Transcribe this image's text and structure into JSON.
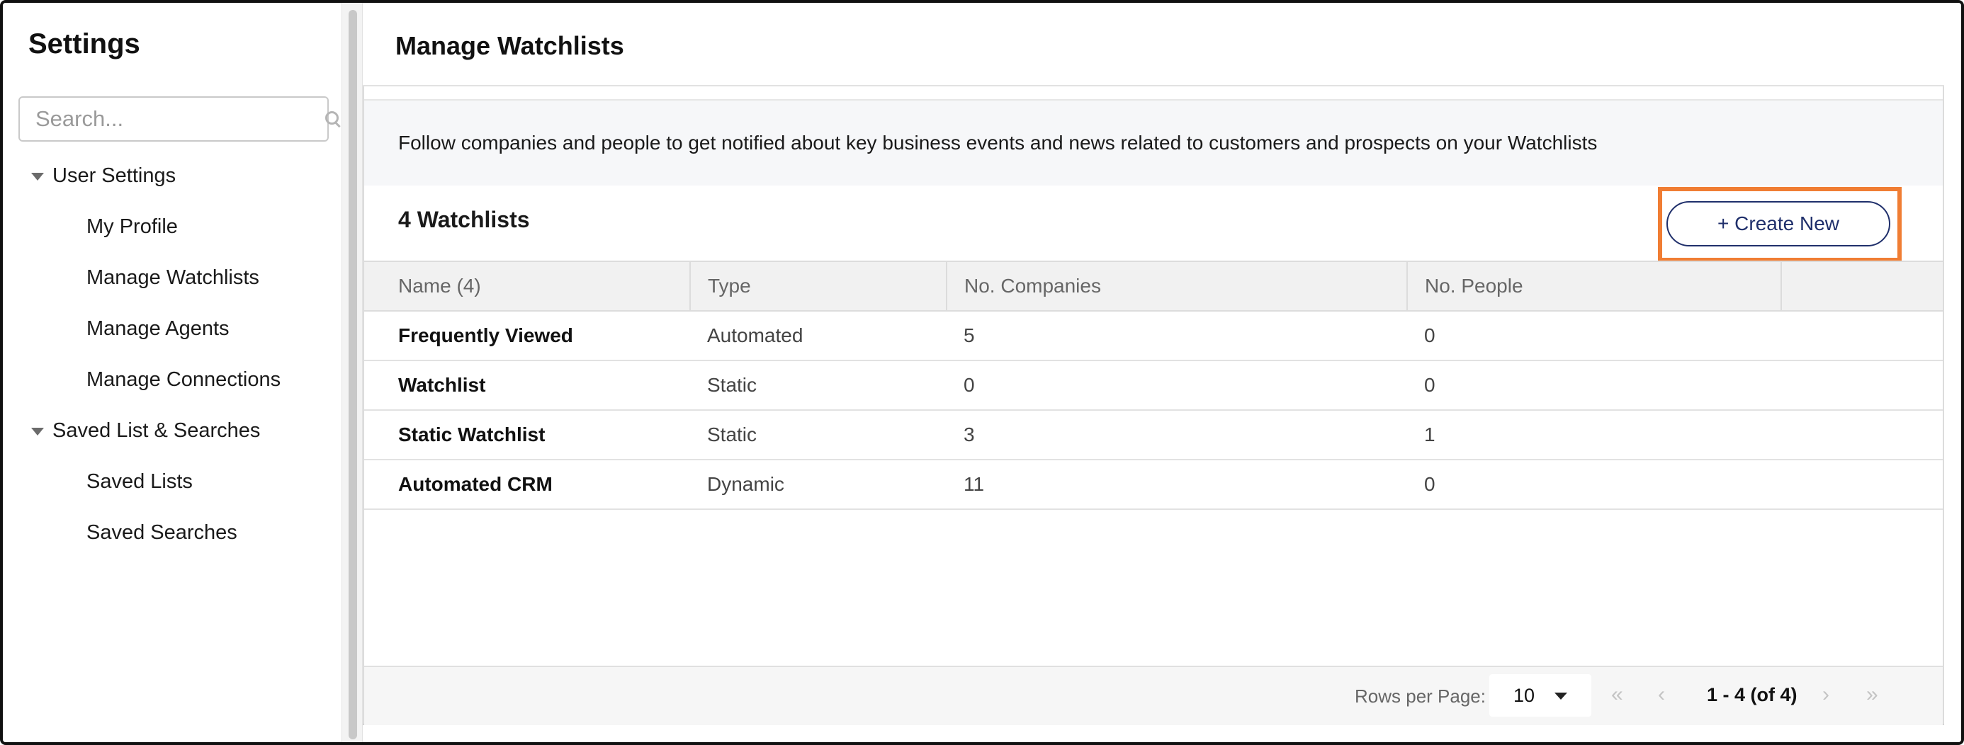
{
  "sidebar": {
    "title": "Settings",
    "search": {
      "placeholder": "Search...",
      "value": ""
    },
    "groups": [
      {
        "label": "User Settings",
        "items": [
          "My Profile",
          "Manage Watchlists",
          "Manage Agents",
          "Manage Connections"
        ]
      },
      {
        "label": "Saved List & Searches",
        "items": [
          "Saved Lists",
          "Saved Searches"
        ]
      }
    ]
  },
  "main": {
    "title": "Manage Watchlists",
    "info": "Follow companies and people to get notified about key business events and news related to customers and prospects on your Watchlists",
    "count_label": "4 Watchlists",
    "create_button": "+ Create New",
    "highlight_color": "#f07d33",
    "table": {
      "headers": [
        "Name (4)",
        "Type",
        "No. Companies",
        "No. People",
        ""
      ],
      "rows": [
        [
          "Frequently Viewed",
          "Automated",
          "5",
          "0"
        ],
        [
          "Watchlist",
          "Static",
          "0",
          "0"
        ],
        [
          "Static Watchlist",
          "Static",
          "3",
          "1"
        ],
        [
          "Automated CRM",
          "Dynamic",
          "11",
          "0"
        ]
      ]
    },
    "pagination": {
      "rows_per_page_label": "Rows per Page:",
      "rows_per_page_value": "10",
      "range": "1 - 4 (of 4)",
      "first": "«",
      "prev": "‹",
      "next": "›",
      "last": "»"
    }
  }
}
